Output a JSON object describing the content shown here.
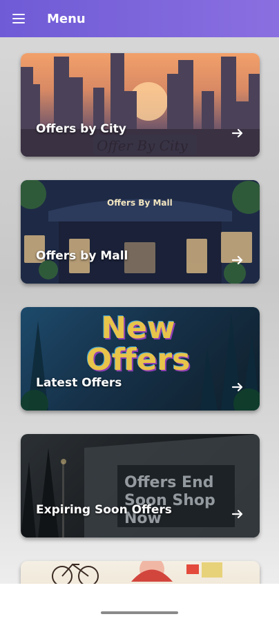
{
  "app_bar": {
    "title": "Menu",
    "menu_icon": "hamburger-icon",
    "accent_color": "#7b63dc"
  },
  "menu_cards": [
    {
      "label": "Offers by City",
      "image_text": "Offer By City",
      "icon": "arrow-right-icon"
    },
    {
      "label": "Offers by Mall",
      "image_text": "Offers By Mall",
      "icon": "arrow-right-icon"
    },
    {
      "label": "Latest Offers",
      "image_text": "New Offers",
      "icon": "arrow-right-icon"
    },
    {
      "label": "Expiring Soon Offers",
      "image_text": "Offers End Soon Shop Now",
      "icon": "arrow-right-icon"
    }
  ],
  "system_nav": {
    "gesture_bar": "gesture-handle"
  }
}
